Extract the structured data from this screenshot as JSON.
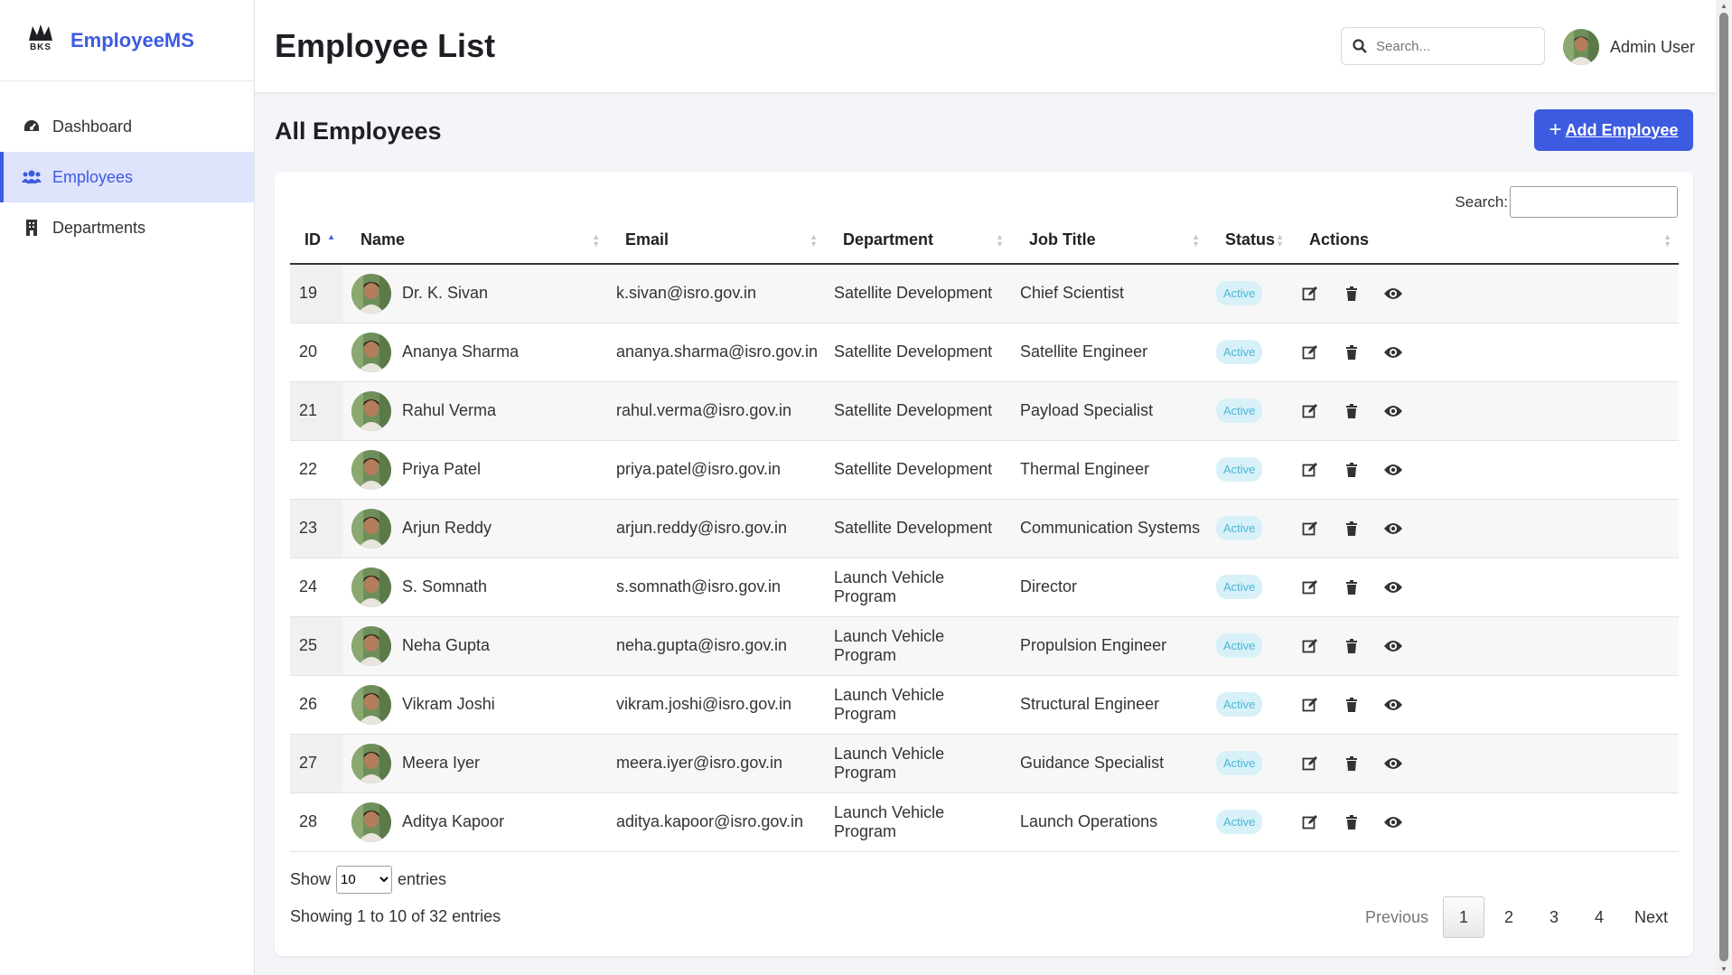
{
  "brand": {
    "logo_text": "BKS",
    "name": "EmployeeMS"
  },
  "sidebar": {
    "items": [
      {
        "label": "Dashboard",
        "icon": "gauge-icon"
      },
      {
        "label": "Employees",
        "icon": "users-icon",
        "active": true
      },
      {
        "label": "Departments",
        "icon": "building-icon"
      }
    ]
  },
  "header": {
    "title": "Employee List",
    "search_placeholder": "Search...",
    "user_name": "Admin User"
  },
  "main": {
    "section_title": "All Employees",
    "add_button": "Add Employee",
    "table_search_label": "Search:"
  },
  "table": {
    "columns": [
      "ID",
      "Name",
      "Email",
      "Department",
      "Job Title",
      "Status",
      "Actions"
    ],
    "rows": [
      {
        "id": "19",
        "name": "Dr. K. Sivan",
        "email": "k.sivan@isro.gov.in",
        "department": "Satellite Development",
        "job_title": "Chief Scientist",
        "status": "Active"
      },
      {
        "id": "20",
        "name": "Ananya Sharma",
        "email": "ananya.sharma@isro.gov.in",
        "department": "Satellite Development",
        "job_title": "Satellite Engineer",
        "status": "Active"
      },
      {
        "id": "21",
        "name": "Rahul Verma",
        "email": "rahul.verma@isro.gov.in",
        "department": "Satellite Development",
        "job_title": "Payload Specialist",
        "status": "Active"
      },
      {
        "id": "22",
        "name": "Priya Patel",
        "email": "priya.patel@isro.gov.in",
        "department": "Satellite Development",
        "job_title": "Thermal Engineer",
        "status": "Active"
      },
      {
        "id": "23",
        "name": "Arjun Reddy",
        "email": "arjun.reddy@isro.gov.in",
        "department": "Satellite Development",
        "job_title": "Communication Systems",
        "status": "Active"
      },
      {
        "id": "24",
        "name": "S. Somnath",
        "email": "s.somnath@isro.gov.in",
        "department": "Launch Vehicle Program",
        "job_title": "Director",
        "status": "Active"
      },
      {
        "id": "25",
        "name": "Neha Gupta",
        "email": "neha.gupta@isro.gov.in",
        "department": "Launch Vehicle Program",
        "job_title": "Propulsion Engineer",
        "status": "Active"
      },
      {
        "id": "26",
        "name": "Vikram Joshi",
        "email": "vikram.joshi@isro.gov.in",
        "department": "Launch Vehicle Program",
        "job_title": "Structural Engineer",
        "status": "Active"
      },
      {
        "id": "27",
        "name": "Meera Iyer",
        "email": "meera.iyer@isro.gov.in",
        "department": "Launch Vehicle Program",
        "job_title": "Guidance Specialist",
        "status": "Active"
      },
      {
        "id": "28",
        "name": "Aditya Kapoor",
        "email": "aditya.kapoor@isro.gov.in",
        "department": "Launch Vehicle Program",
        "job_title": "Launch Operations",
        "status": "Active"
      }
    ]
  },
  "footer": {
    "show_label": "Show",
    "entries_label": "entries",
    "page_size": "10",
    "info": "Showing 1 to 10 of 32 entries",
    "pagination": {
      "previous": "Previous",
      "pages": [
        "1",
        "2",
        "3",
        "4"
      ],
      "current": "1",
      "next": "Next"
    }
  },
  "colors": {
    "accent": "#3d5be0",
    "active_nav_bg": "#dfe3fb",
    "badge_bg": "#d8f1f8",
    "badge_text": "#49b6d6"
  }
}
